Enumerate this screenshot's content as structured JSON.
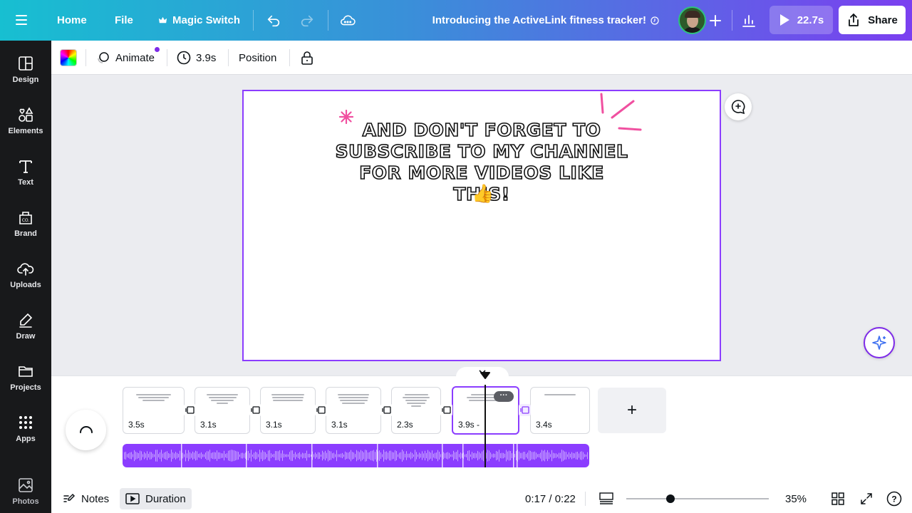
{
  "topbar": {
    "home": "Home",
    "file": "File",
    "magic_switch": "Magic Switch",
    "doc_title": "Introducing the ActiveLink fitness tracker!",
    "play_duration": "22.7s",
    "share": "Share"
  },
  "sidebar": {
    "items": [
      {
        "label": "Design",
        "icon": "layout-icon"
      },
      {
        "label": "Elements",
        "icon": "shapes-icon"
      },
      {
        "label": "Text",
        "icon": "text-icon"
      },
      {
        "label": "Brand",
        "icon": "brand-icon"
      },
      {
        "label": "Uploads",
        "icon": "cloud-upload-icon"
      },
      {
        "label": "Draw",
        "icon": "pen-icon"
      },
      {
        "label": "Projects",
        "icon": "folder-icon"
      },
      {
        "label": "Apps",
        "icon": "apps-grid-icon"
      },
      {
        "label": "Photos",
        "icon": "image-icon"
      }
    ]
  },
  "toolbar": {
    "animate": "Animate",
    "duration": "3.9s",
    "position": "Position"
  },
  "canvas": {
    "text": "AND DON'T FORGET TO SUBSCRIBE TO MY CHANNEL FOR MORE VIDEOS LIKE THIS!",
    "emoji": "👍",
    "accent_color": "#f050a0"
  },
  "timeline": {
    "pages": [
      {
        "duration": "3.5s"
      },
      {
        "duration": "3.1s"
      },
      {
        "duration": "3.1s"
      },
      {
        "duration": "3.1s"
      },
      {
        "duration": "2.3s"
      },
      {
        "duration": "3.9s -"
      },
      {
        "duration": "3.4s"
      }
    ],
    "more": "···",
    "add": "+"
  },
  "bottombar": {
    "notes": "Notes",
    "duration": "Duration",
    "time": "0:17 / 0:22",
    "zoom": "35%",
    "zoom_level": 0.31,
    "help": "?"
  },
  "colors": {
    "accent": "#8b3dff",
    "sidebar_bg": "#18191b",
    "topbar_start": "#17bfd1",
    "topbar_end": "#7b3ff0"
  }
}
